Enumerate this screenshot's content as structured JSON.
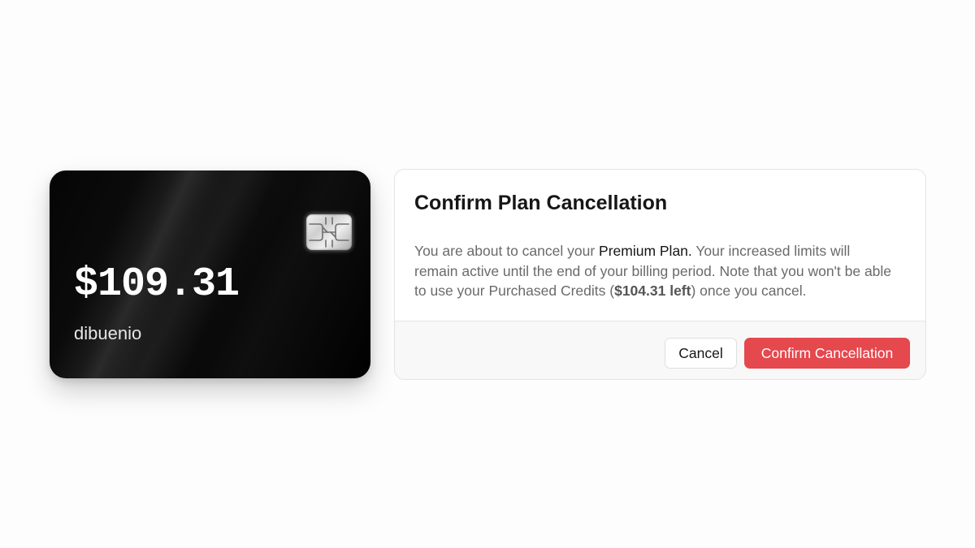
{
  "card": {
    "amount": "$109.31",
    "holder": "dibuenio",
    "chip_icon": "sim-chip-icon"
  },
  "dialog": {
    "title": "Confirm Plan Cancellation",
    "body": {
      "part1": "You are about to cancel your ",
      "plan_name": "Premium Plan.",
      "part2": " Your increased limits will remain active until the end of your billing period. Note that you won't be able to use your Purchased Credits (",
      "credits_left": "$104.31 left",
      "part3": ") once you cancel."
    },
    "cancel_label": "Cancel",
    "confirm_label": "Confirm Cancellation"
  },
  "colors": {
    "confirm_button": "#e5484d",
    "card_background": "#000000",
    "page_background": "#fdfdfd"
  }
}
